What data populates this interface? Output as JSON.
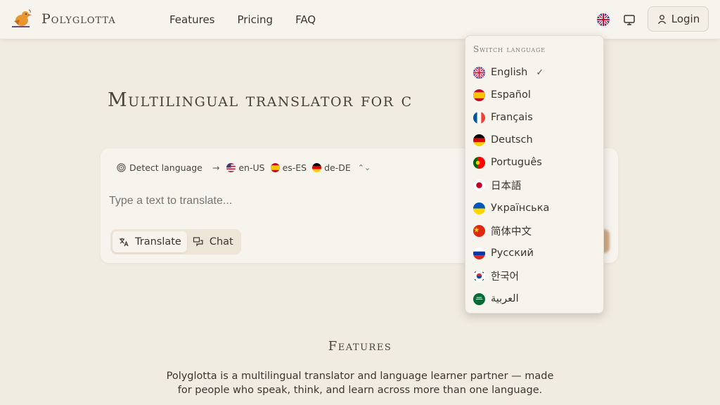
{
  "header": {
    "brand": "Polyglotta",
    "nav": [
      "Features",
      "Pricing",
      "FAQ"
    ],
    "login_label": "Login"
  },
  "hero": {
    "title": "Multilingual translator for c"
  },
  "translator": {
    "detect_label": "Detect language",
    "targets": [
      {
        "code": "en-US",
        "flag": "us"
      },
      {
        "code": "es-ES",
        "flag": "es"
      },
      {
        "code": "de-DE",
        "flag": "de"
      }
    ],
    "placeholder": "Type a text to translate...",
    "modes": [
      "Translate",
      "Chat"
    ],
    "active_mode": "Translate"
  },
  "language_menu": {
    "title": "Switch language",
    "selected": "English",
    "items": [
      {
        "label": "English",
        "flag": "gb"
      },
      {
        "label": "Español",
        "flag": "es"
      },
      {
        "label": "Français",
        "flag": "fr"
      },
      {
        "label": "Deutsch",
        "flag": "de"
      },
      {
        "label": "Português",
        "flag": "pt"
      },
      {
        "label": "日本語",
        "flag": "jp"
      },
      {
        "label": "Українська",
        "flag": "ua"
      },
      {
        "label": "简体中文",
        "flag": "cn"
      },
      {
        "label": "Русский",
        "flag": "ru"
      },
      {
        "label": "한국어",
        "flag": "kr"
      },
      {
        "label": "العربية",
        "flag": "sa"
      }
    ]
  },
  "features": {
    "title": "Features",
    "description": "Polyglotta is a multilingual translator and language learner partner — made for people who speak, think, and learn across more than one language."
  },
  "colors": {
    "background": "#f1ece2",
    "surface": "#f7f4ee",
    "accent": "#c99d72"
  }
}
